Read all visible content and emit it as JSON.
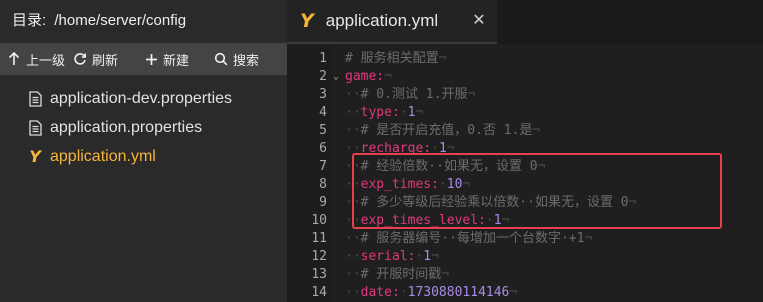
{
  "sidebar": {
    "dir_label": "目录:",
    "dir_path": "/home/server/config",
    "toolbar": {
      "up": "上一级",
      "refresh": "刷新",
      "new": "新建",
      "search": "搜索"
    },
    "files": [
      "application-dev.properties",
      "application.properties",
      "application.yml"
    ]
  },
  "editor": {
    "tab_icon": "Y",
    "tab_title": "application.yml",
    "close_glyph": "✕",
    "fold_glyph": "⌄",
    "lines": [
      {
        "n": "1",
        "indent": "",
        "comment": "# 服务相关配置"
      },
      {
        "n": "2",
        "indent": "",
        "key": "game:"
      },
      {
        "n": "3",
        "indent": "··",
        "comment": "# 0.测试 1.开服"
      },
      {
        "n": "4",
        "indent": "··",
        "key": "type:",
        "value": "1"
      },
      {
        "n": "5",
        "indent": "··",
        "comment": "# 是否开启充值，0.否 1.是"
      },
      {
        "n": "6",
        "indent": "··",
        "key": "recharge:",
        "value": "1"
      },
      {
        "n": "7",
        "indent": "··",
        "comment": "# 经验倍数··如果无，设置 0"
      },
      {
        "n": "8",
        "indent": "··",
        "key": "exp_times:",
        "value": "10"
      },
      {
        "n": "9",
        "indent": "··",
        "comment": "# 多少等级后经验乘以倍数··如果无，设置 0"
      },
      {
        "n": "10",
        "indent": "··",
        "key": "exp_times_level:",
        "value": "1"
      },
      {
        "n": "11",
        "indent": "··",
        "comment": "# 服务器编号··每增加一个台数字·+1"
      },
      {
        "n": "12",
        "indent": "··",
        "key": "serial:",
        "value": "1"
      },
      {
        "n": "13",
        "indent": "··",
        "comment": "# 开服时间戳"
      },
      {
        "n": "14",
        "indent": "··",
        "key": "date:",
        "value": "1730880114146"
      }
    ]
  }
}
